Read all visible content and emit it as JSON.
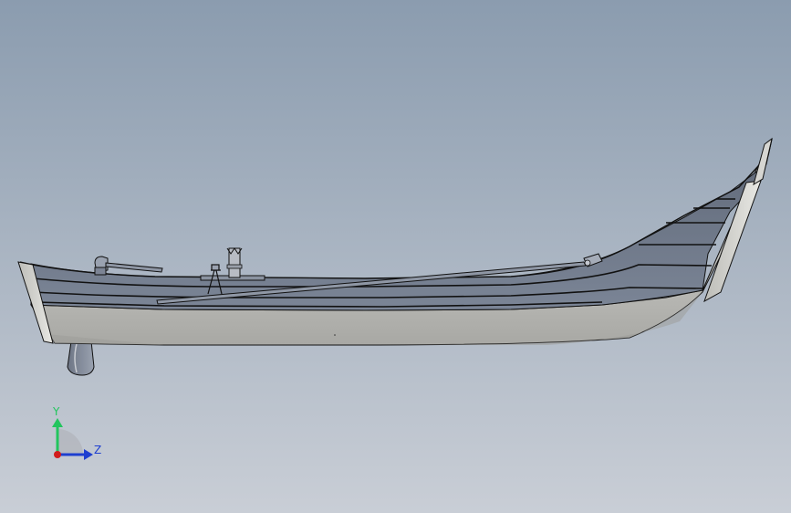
{
  "viewport": {
    "background_top": "#8b9caf",
    "background_bottom": "#c9ced6"
  },
  "model": {
    "hull_inner_color": "#707a8c",
    "hull_outer_color": "#c7c7c4",
    "edge_color": "#111111"
  },
  "triad": {
    "y_label": "Y",
    "z_label": "Z",
    "y_color": "#22c55e",
    "z_color": "#1e3fd0",
    "x_color": "#d11c1c"
  }
}
